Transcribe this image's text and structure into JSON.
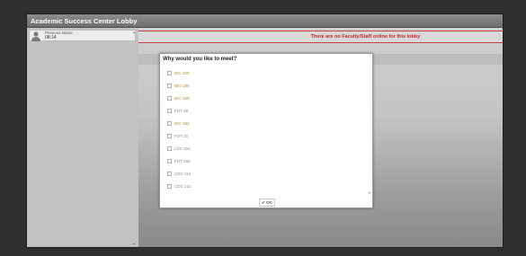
{
  "window": {
    "title": "Academic Success Center Lobby"
  },
  "sidebar": {
    "user": {
      "name": "Previous Name",
      "time": "08:14"
    },
    "scroll_up": "▴",
    "scroll_down": "▾"
  },
  "main": {
    "banner": "There are no Faculty/Staff online for this lobby"
  },
  "modal": {
    "title": "Why would you like to meet?",
    "options": [
      {
        "label": "DIC 100",
        "highlighted": true
      },
      {
        "label": "BIO 180",
        "highlighted": true
      },
      {
        "label": "DIC 160",
        "highlighted": true
      },
      {
        "label": "FOT 49",
        "highlighted": false
      },
      {
        "label": "DIC 183",
        "highlighted": true
      },
      {
        "label": "FOT 20",
        "highlighted": false
      },
      {
        "label": "LDC 201",
        "highlighted": false
      },
      {
        "label": "FOT 205",
        "highlighted": false
      },
      {
        "label": "CDC 110",
        "highlighted": false
      },
      {
        "label": "CDC 121",
        "highlighted": false
      }
    ],
    "ok_label": "✔ OK",
    "scroll_indicator": "▾"
  },
  "colors": {
    "banner_text": "#c62828",
    "highlight_option": "#b8862b",
    "page_background": "#303030"
  }
}
